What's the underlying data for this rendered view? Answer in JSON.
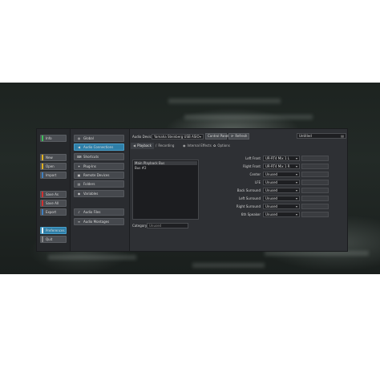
{
  "sidebar": {
    "buttons": [
      {
        "label": "Info",
        "marker_color": "#3fbf5a"
      },
      {
        "label": "New",
        "marker_color": "#e0b020"
      },
      {
        "label": "Open",
        "marker_color": "#e0b020"
      },
      {
        "label": "Import",
        "marker_color": "#3f7fbf"
      },
      {
        "label": "Save As",
        "marker_color": "#d03030"
      },
      {
        "label": "Save All",
        "marker_color": "#d03030"
      },
      {
        "label": "Export",
        "marker_color": "#3f7fbf"
      },
      {
        "label": "Preferences",
        "marker_color": "#ffffff"
      },
      {
        "label": "Quit",
        "marker_color": "#888888"
      }
    ]
  },
  "prefs_list": {
    "items": [
      {
        "label": "Global",
        "icon": "globe-icon",
        "glyph": "◍"
      },
      {
        "label": "Audio Connections",
        "icon": "speaker-icon",
        "glyph": "◀"
      },
      {
        "label": "Shortcuts",
        "icon": "keyboard-icon",
        "glyph": "⌨"
      },
      {
        "label": "Plug-Ins",
        "icon": "plug-icon",
        "glyph": "✦"
      },
      {
        "label": "Remote Devices",
        "icon": "remote-icon",
        "glyph": "▣"
      },
      {
        "label": "Folders",
        "icon": "folder-icon",
        "glyph": "▤"
      },
      {
        "label": "Variables",
        "icon": "tag-icon",
        "glyph": "◆"
      },
      {
        "label": "Audio Files",
        "icon": "audio-file-icon",
        "glyph": "♪"
      },
      {
        "label": "Audio Montages",
        "icon": "montage-icon",
        "glyph": "≡"
      }
    ]
  },
  "toolbar": {
    "audio_device_label": "Audio Device",
    "audio_device_value": "Yamaha Steinberg USB ASIO",
    "control_panel_label": "Control Panel",
    "refresh_label": "Refresh",
    "preset_value": "Untitled"
  },
  "tabs": [
    {
      "label": "Playback",
      "icon": "speaker-icon",
      "glyph": "◀"
    },
    {
      "label": "Recording",
      "icon": "mic-icon",
      "glyph": "/"
    },
    {
      "label": "Internal Effects",
      "icon": "eye-icon",
      "glyph": "◉"
    },
    {
      "label": "Options",
      "icon": "gear-icon",
      "glyph": "✿"
    }
  ],
  "bus_list": [
    "Main Playback Bus",
    "Bus #2"
  ],
  "category": {
    "label": "Category",
    "value": "Unused"
  },
  "channels": [
    {
      "label": "Left Front",
      "value": "UR-RT4 Mix 1 L"
    },
    {
      "label": "Right Front",
      "value": "UR-RT4 Mix 1 R"
    },
    {
      "label": "Center",
      "value": "Unused"
    },
    {
      "label": "LFE",
      "value": "Unused"
    },
    {
      "label": "Back Surround",
      "value": "Unused"
    },
    {
      "label": "Left Surround",
      "value": "Unused"
    },
    {
      "label": "Right Surround",
      "value": "Unused"
    },
    {
      "label": "6th Speaker",
      "value": "Unused"
    }
  ]
}
